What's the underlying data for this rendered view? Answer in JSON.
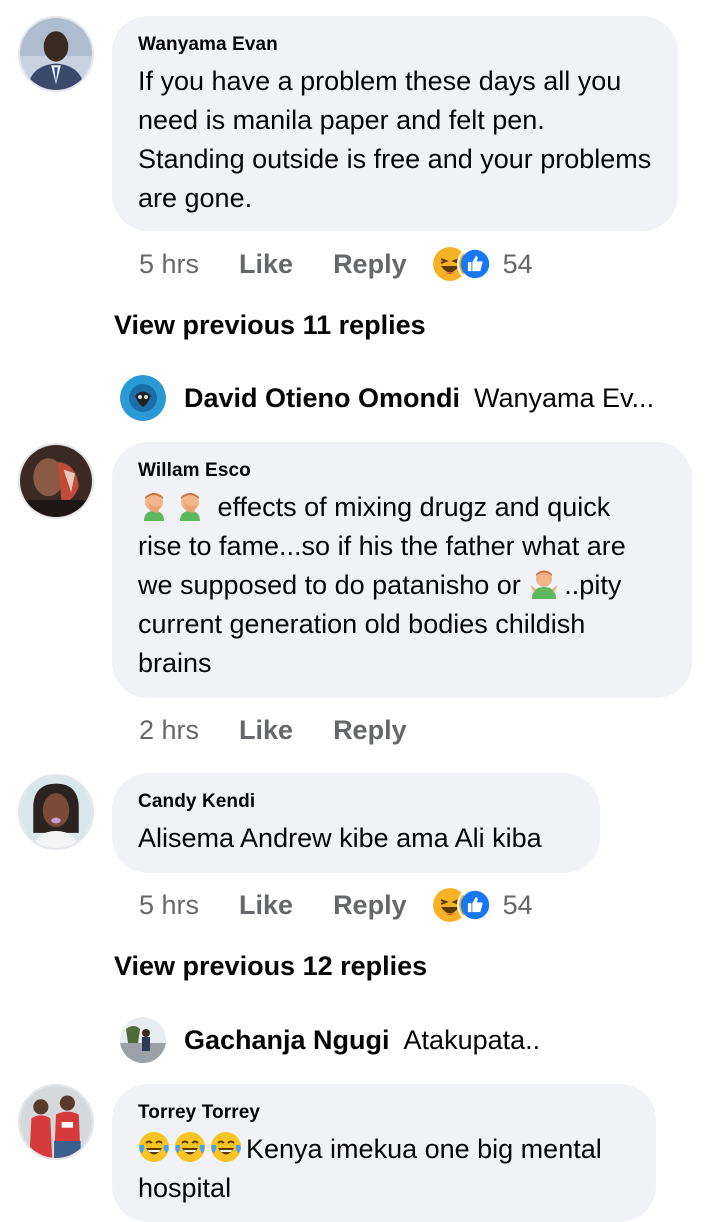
{
  "comments": [
    {
      "author": "Wanyama Evan",
      "text": "If you have a problem these days all you need is manila paper and felt pen. Standing outside is free and your problems are gone.",
      "time": "5 hrs",
      "like_label": "Like",
      "reply_label": "Reply",
      "reaction_count": "54",
      "view_previous": "View previous 11 replies",
      "latest_reply": {
        "author": "David Otieno Omondi",
        "text": "Wanyama Ev..."
      }
    },
    {
      "author": "Willam Esco",
      "text_line1": "effects of mixing drugz and quick",
      "text_line2": "rise to fame...so if his the father what are",
      "text_line3a": "we supposed to do patanisho or",
      "text_line3b": "..pity",
      "text_line4": "current generation old bodies childish",
      "text_line5": "brains",
      "time": "2 hrs",
      "like_label": "Like",
      "reply_label": "Reply"
    },
    {
      "author": "Candy Kendi",
      "text": "Alisema Andrew kibe ama Ali kiba",
      "time": "5 hrs",
      "like_label": "Like",
      "reply_label": "Reply",
      "reaction_count": "54",
      "view_previous": "View previous 12 replies",
      "latest_reply": {
        "author": "Gachanja Ngugi",
        "text": "Atakupata.."
      }
    },
    {
      "author": "Torrey Torrey",
      "text_line1": "Kenya imekua one big mental",
      "text_line2": "hospital"
    }
  ],
  "icons": {
    "reaction_haha": "haha-icon",
    "reaction_like": "like-icon",
    "facepalm": "facepalm-emoji-icon",
    "shrug": "shrug-emoji-icon",
    "laughing": "laughing-tears-emoji-icon"
  },
  "colors": {
    "bubble": "#f0f2f5",
    "secondary_text": "#65676b",
    "like_blue": "#1877f2",
    "haha_yellow": "#f7b125"
  }
}
